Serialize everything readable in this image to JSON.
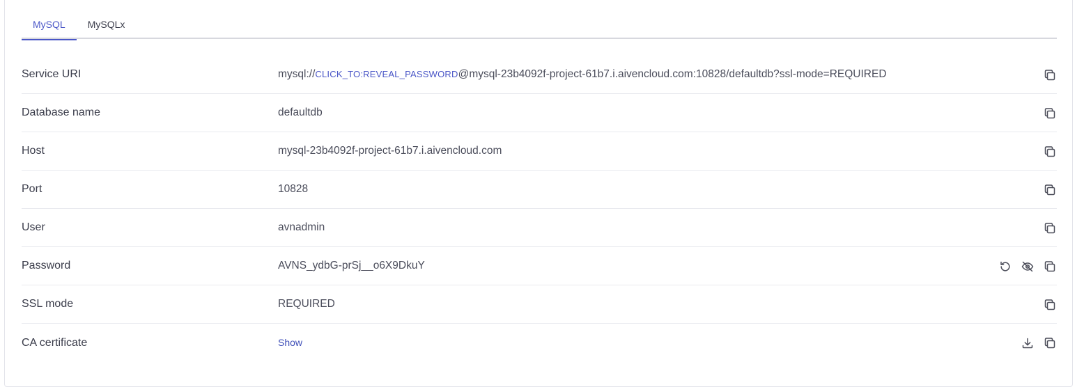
{
  "tabs": [
    {
      "label": "MySQL",
      "active": true
    },
    {
      "label": "MySQLx",
      "active": false
    }
  ],
  "rows": {
    "service_uri": {
      "label": "Service URI",
      "prefix": "mysql://",
      "reveal": "CLICK_TO:REVEAL_PASSWORD",
      "suffix": "@mysql-23b4092f-project-61b7.i.aivencloud.com:10828/defaultdb?ssl-mode=REQUIRED"
    },
    "database_name": {
      "label": "Database name",
      "value": "defaultdb"
    },
    "host": {
      "label": "Host",
      "value": "mysql-23b4092f-project-61b7.i.aivencloud.com"
    },
    "port": {
      "label": "Port",
      "value": "10828"
    },
    "user": {
      "label": "User",
      "value": "avnadmin"
    },
    "password": {
      "label": "Password",
      "value": "AVNS_ydbG-prSj__o6X9DkuY"
    },
    "ssl_mode": {
      "label": "SSL mode",
      "value": "REQUIRED"
    },
    "ca_certificate": {
      "label": "CA certificate",
      "link": "Show"
    }
  },
  "icons": {
    "copy": "copy-icon",
    "reset": "reset-icon",
    "hide": "eye-off-icon",
    "download": "download-icon"
  },
  "colors": {
    "accent": "#4a56c7",
    "text": "#3a3c4a",
    "divider": "#e8e9ee"
  }
}
